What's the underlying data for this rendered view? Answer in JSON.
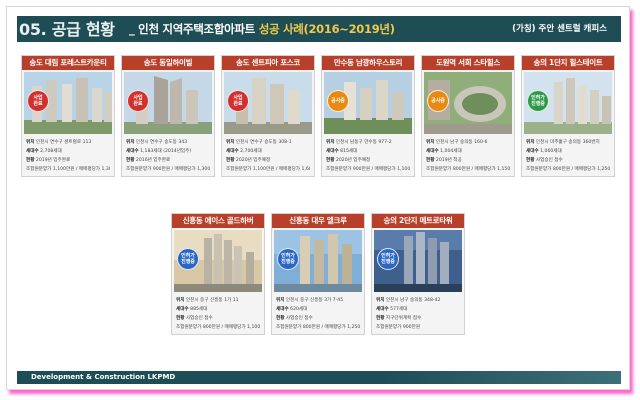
{
  "header": {
    "title": "05. 공급 현황",
    "separator": "_",
    "subtitle_prefix": "인천 지역주택조합아파트",
    "subtitle_accent": "성공 사례(2016~2019년)",
    "brand": "(가칭) 주안 센트럴 캐피스"
  },
  "cards": [
    {
      "title": "송도 대림 포레스트카운티",
      "badge": "사업\n완료",
      "location": "인천시 연수구 센트럴로 113",
      "units": "2,708세대",
      "status": "2019년 입주완료",
      "prices": "조합원분양가 1,100만원 / 매매평당가 1,300만원"
    },
    {
      "title": "송도 동일하이빌",
      "badge": "사업\n완료",
      "location": "인천시 연수구 송도동 343",
      "units": "1,183세대 (2014년입주)",
      "status": "2016년 입주완료",
      "prices": "조합원분양가 900만원 / 매매평당가 1,300만원"
    },
    {
      "title": "송도 센트피아 포스코",
      "badge": "사업\n완료",
      "location": "인천시 연수구 송도동 308-1",
      "units": "2,700세대",
      "status": "2020년 입주예정",
      "prices": "조합원분양가 1,100만원 / 매매평당가 1,600만원"
    },
    {
      "title": "만수동 남광하우스토리",
      "badge": "공사중",
      "location": "인천시 남동구 만수동 977-2",
      "units": "815세대",
      "status": "2020년 입주예정",
      "prices": "조합원분양가 900만원 / 매매평당가 1,100만원"
    },
    {
      "title": "도원역 서희 스타힐스",
      "badge": "공사중",
      "location": "인천시 남구 숭의동 160-6",
      "units": "1,004세대",
      "status": "2019년 착공",
      "prices": "조합원분양가 800만원 / 매매평당가 1,150만원"
    },
    {
      "title": "송의 1단지 힐스테이트",
      "badge": "인허가\n진행중",
      "location": "인천시 미추홀구 송의동 360번지",
      "units": "1,060세대",
      "status": "사업승인 접수",
      "prices": "조합원분양가 800만원 / 매매평당가 1,250만원"
    },
    {
      "title": "신흥동 에이스 골드하버",
      "badge": "인허가\n진행중",
      "location": "인천시 중구 신흥동 1가 11",
      "units": "885세대",
      "status": "사업승인 접수",
      "prices": "조합원분양가 800만원 / 매매평당가 1,100만원"
    },
    {
      "title": "신흥동 대우 엘크루",
      "badge": "인허가\n진행중",
      "location": "인천시 중구 신흥동 3가 7-45",
      "units": "620세대",
      "status": "사업승인 접수",
      "prices": "조합원분양가 800만원 / 매매평당가 1,250만원"
    },
    {
      "title": "숭의 2단지 메트로타워",
      "badge": "인허가\n진행중",
      "location": "인천시 남구 숭의동 348-42",
      "units": "577세대",
      "status": "지구단위계획 접수",
      "prices": "조합원분양가 900만원"
    }
  ],
  "labels": {
    "location": "위치",
    "units": "세대수",
    "status": "현황"
  },
  "footer": {
    "text": "Development & Construction LKPMD"
  }
}
